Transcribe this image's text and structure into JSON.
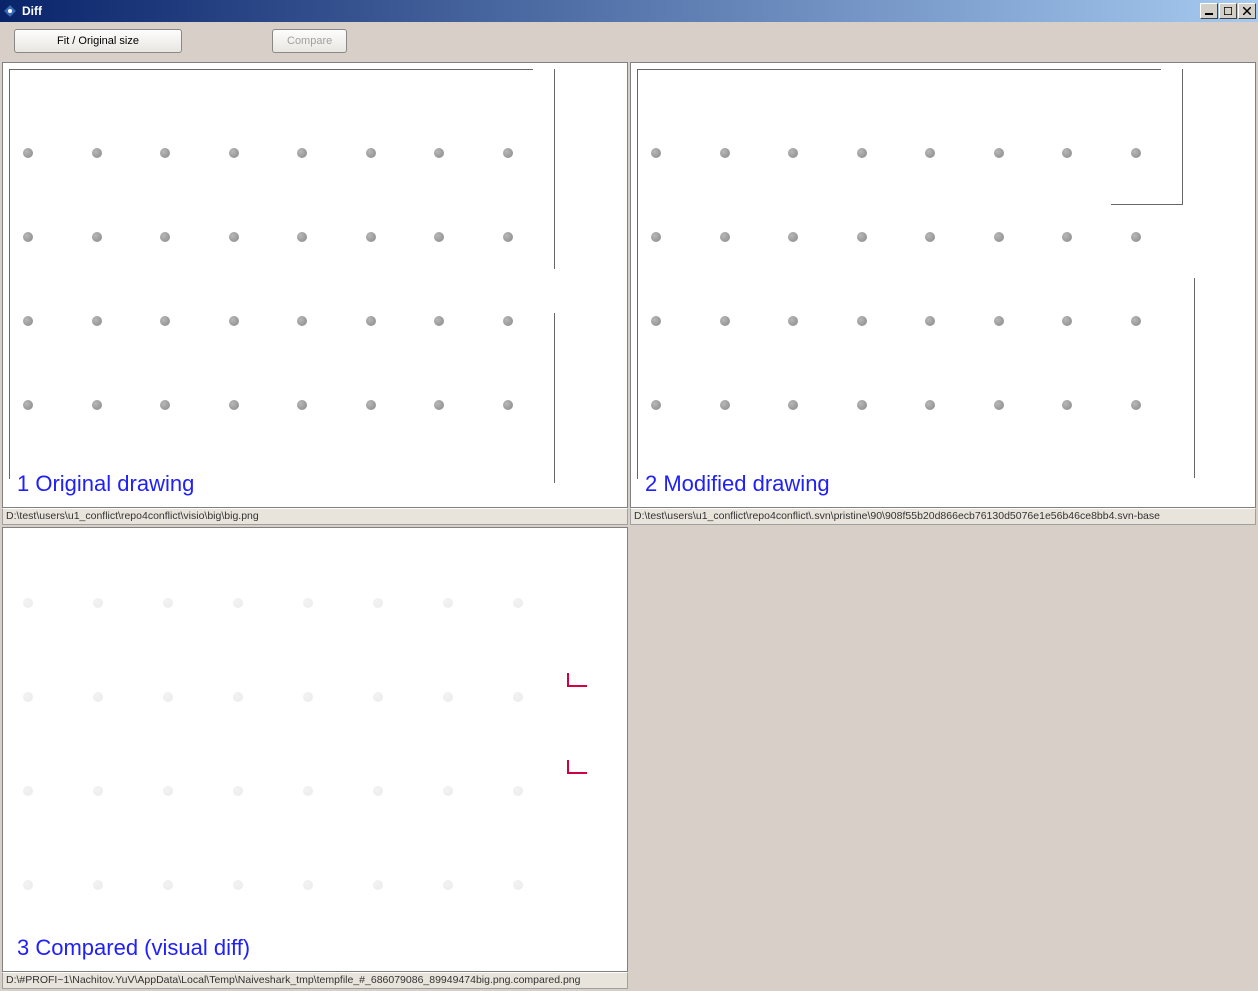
{
  "window": {
    "title": "Diff"
  },
  "toolbar": {
    "fit_original_label": "Fit / Original size",
    "compare_label": "Compare"
  },
  "panels": {
    "original": {
      "label": "1 Original drawing",
      "path": "D:\\test\\users\\u1_conflict\\repo4conflict\\visio\\big\\big.png"
    },
    "modified": {
      "label": "2 Modified drawing",
      "path": "D:\\test\\users\\u1_conflict\\repo4conflict\\.svn\\pristine\\90\\908f55b20d866ecb76130d5076e1e56b46ce8bb4.svn-base"
    },
    "compared": {
      "label": "3 Compared (visual diff)",
      "path": "D:\\#PROFI~1\\Nachitov.YuV\\AppData\\Local\\Temp\\Naiveshark_tmp\\tempfile_#_686079086_89949474big.png.compared.png"
    }
  }
}
